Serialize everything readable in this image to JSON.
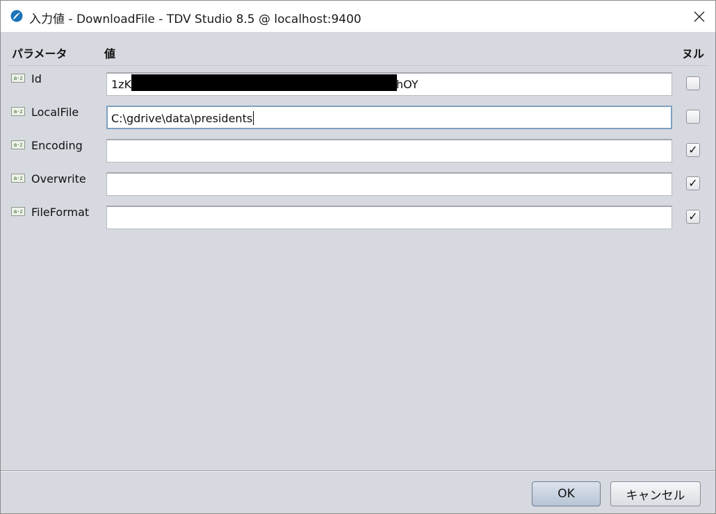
{
  "window": {
    "title": "入力値 - DownloadFile - TDV Studio 8.5 @ localhost:9400"
  },
  "columns": {
    "parameter": "パラメータ",
    "value": "値",
    "null": "ヌル"
  },
  "rows": [
    {
      "name": "Id",
      "type_icon": "a·z",
      "value_visible_start": "1zK",
      "value_visible_end": "hOY",
      "value_redacted": true,
      "null_checked": false
    },
    {
      "name": "LocalFile",
      "type_icon": "a·z",
      "value": "C:\\gdrive\\data\\presidents",
      "focused": true,
      "null_checked": false
    },
    {
      "name": "Encoding",
      "type_icon": "a·z",
      "value": "",
      "null_checked": true
    },
    {
      "name": "Overwrite",
      "type_icon": "a·z",
      "value": "",
      "null_checked": true
    },
    {
      "name": "FileFormat",
      "type_icon": "a·z",
      "value": "",
      "null_checked": true
    }
  ],
  "buttons": {
    "ok": "OK",
    "cancel": "キャンセル"
  },
  "check_mark": "✓",
  "colors": {
    "window_bg": "#d6d9df",
    "focus_border": "#7ea0c2",
    "app_icon": "#1b73b8"
  }
}
